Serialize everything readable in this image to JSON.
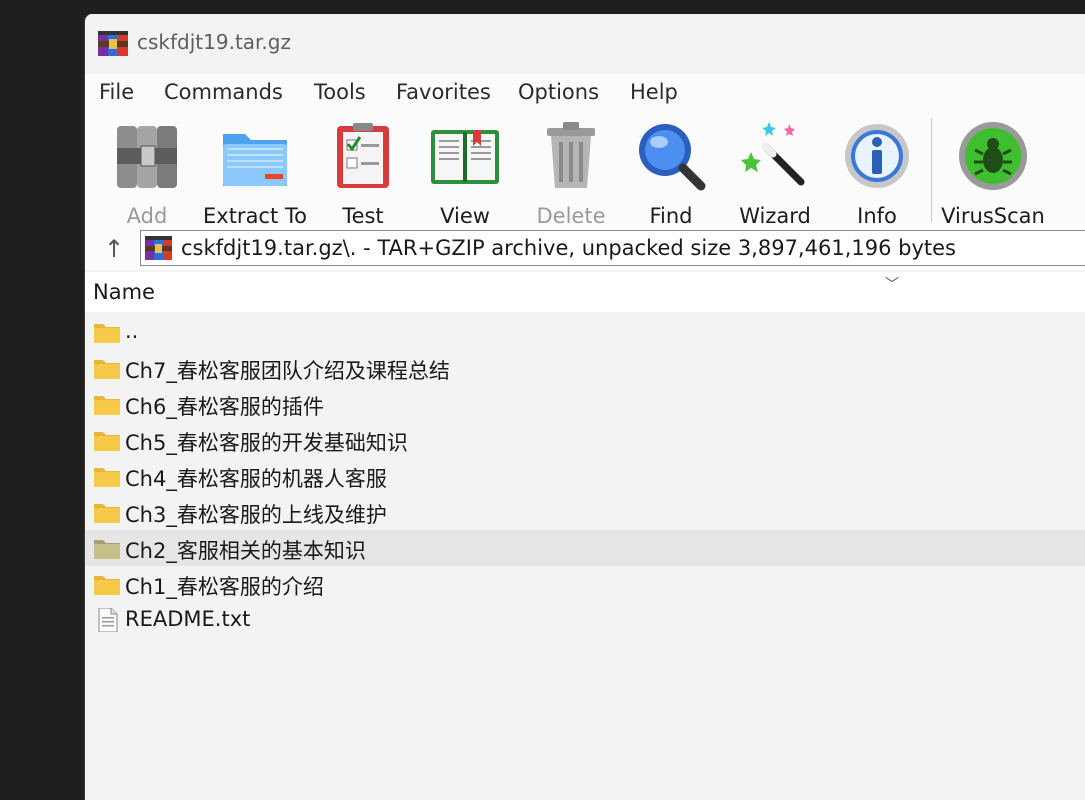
{
  "window": {
    "title": "cskfdjt19.tar.gz"
  },
  "menu": [
    "File",
    "Commands",
    "Tools",
    "Favorites",
    "Options",
    "Help"
  ],
  "toolbar": {
    "add": "Add",
    "extract": "Extract To",
    "test": "Test",
    "view": "View",
    "delete": "Delete",
    "find": "Find",
    "wizard": "Wizard",
    "info": "Info",
    "virusscan": "VirusScan"
  },
  "address": {
    "text": "cskfdjt19.tar.gz\\. - TAR+GZIP archive, unpacked size 3,897,461,196 bytes"
  },
  "list": {
    "column_name": "Name",
    "items": [
      {
        "name": "..",
        "type": "folder"
      },
      {
        "name": "Ch7_春松客服团队介绍及课程总结",
        "type": "folder"
      },
      {
        "name": "Ch6_春松客服的插件",
        "type": "folder"
      },
      {
        "name": "Ch5_春松客服的开发基础知识",
        "type": "folder"
      },
      {
        "name": "Ch4_春松客服的机器人客服",
        "type": "folder"
      },
      {
        "name": "Ch3_春松客服的上线及维护",
        "type": "folder"
      },
      {
        "name": "Ch2_客服相关的基本知识",
        "type": "folder"
      },
      {
        "name": "Ch1_春松客服的介绍",
        "type": "folder"
      },
      {
        "name": "README.txt",
        "type": "file"
      }
    ]
  },
  "colors": {
    "folder": "#f7c948",
    "hover_row": "#e6e6e6",
    "window_bg": "#f3f3f3"
  }
}
